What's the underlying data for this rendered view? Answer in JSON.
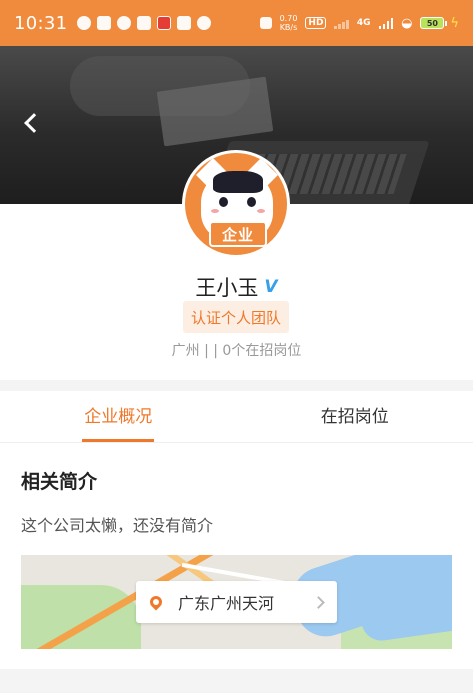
{
  "status_bar": {
    "time": "10:31",
    "speed_value": "0.70",
    "speed_unit": "KB/s",
    "hd": "HD",
    "network": "4G",
    "battery": "50"
  },
  "profile": {
    "avatar_text": "企业",
    "name": "王小玉",
    "verify_mark": "V",
    "tag": "认证个人团队",
    "meta": "广州 |  | 0个在招岗位"
  },
  "tabs": [
    {
      "label": "企业概况",
      "active": true
    },
    {
      "label": "在招岗位",
      "active": false
    }
  ],
  "about": {
    "title": "相关简介",
    "text": "这个公司太懒，还没有简介"
  },
  "location": {
    "text": "广东广州天河"
  },
  "colors": {
    "accent": "#f08a3c",
    "tab_active": "#f0782a",
    "verify": "#37a0e8"
  }
}
